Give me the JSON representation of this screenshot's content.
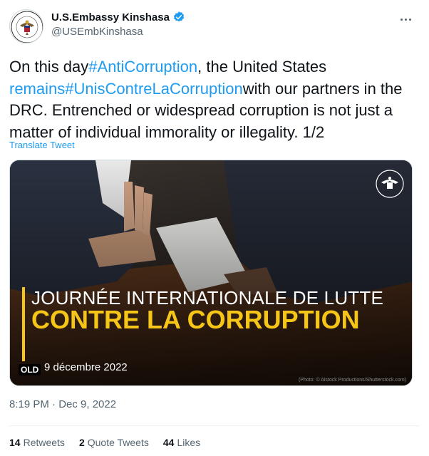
{
  "account": {
    "display_name": "U.S.Embassy Kinshasa",
    "handle": "@USEmbKinshasa",
    "verified_icon": "verified-badge-icon",
    "avatar_text_top": "UNITED STATES EMBASSY",
    "avatar_text_bottom": "KINSHASA"
  },
  "tweet": {
    "part1": "On this day",
    "hashtag1": "#AntiCorruption",
    "part2": ", the United States ",
    "hashtag2": "remains#UnisContreLaCorruption",
    "part3": "with our partners in the DRC. Entrenched or widespread corruption is not just a matter of individual immorality or illegality. 1/2",
    "translate_label": "Translate Tweet"
  },
  "media": {
    "headline_line1": "JOURNÉE INTERNATIONALE DE LUTTE",
    "headline_line2": "CONTRE LA CORRUPTION",
    "date_text": "9 décembre 2022",
    "badge": "OLD",
    "credit": "(Photo: © Aistock Productions/Shutterstock.com)"
  },
  "meta": {
    "timestamp": "8:19 PM · Dec 9, 2022"
  },
  "stats": [
    {
      "count": "14",
      "label": "Retweets"
    },
    {
      "count": "2",
      "label": "Quote Tweets"
    },
    {
      "count": "44",
      "label": "Likes"
    }
  ],
  "colors": {
    "accent": "#1d9bf0",
    "headline_yellow": "#f5c518",
    "text_secondary": "#536471"
  }
}
